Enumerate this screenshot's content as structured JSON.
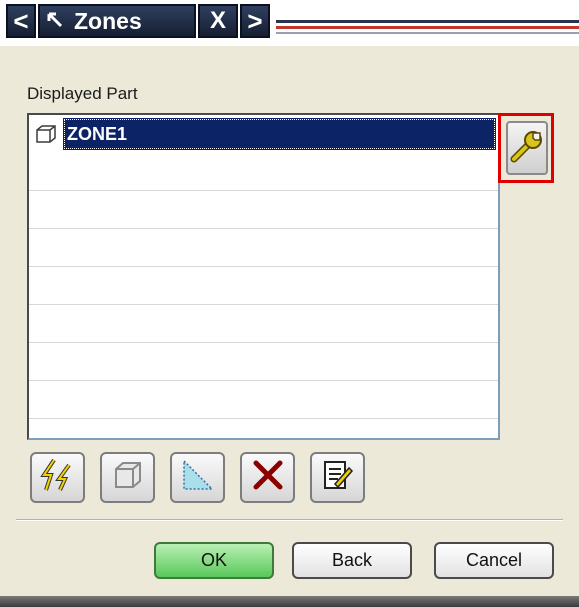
{
  "title_bar": {
    "tab_label": "Zones",
    "prev_glyph": "<",
    "close_glyph": "X",
    "next_glyph": ">"
  },
  "displayed_part": {
    "label": "Displayed Part",
    "items": [
      {
        "label": "ZONE1",
        "icon": "part-cube-icon",
        "selected": true
      }
    ],
    "empty_rows": 7
  },
  "settings_button": {
    "icon": "wrench-icon",
    "highlight_color": "#e00000"
  },
  "toolbar": {
    "buttons": [
      {
        "icon": "lightning-update-icon"
      },
      {
        "icon": "cube-icon"
      },
      {
        "icon": "triangle-region-icon"
      },
      {
        "icon": "delete-x-icon"
      },
      {
        "icon": "edit-pencil-icon"
      }
    ]
  },
  "actions": {
    "ok_label": "OK",
    "back_label": "Back",
    "cancel_label": "Cancel"
  },
  "colors": {
    "selection": "#0c2466",
    "ok_button": "#59c85a",
    "dialog_bg": "#ece9d8"
  }
}
